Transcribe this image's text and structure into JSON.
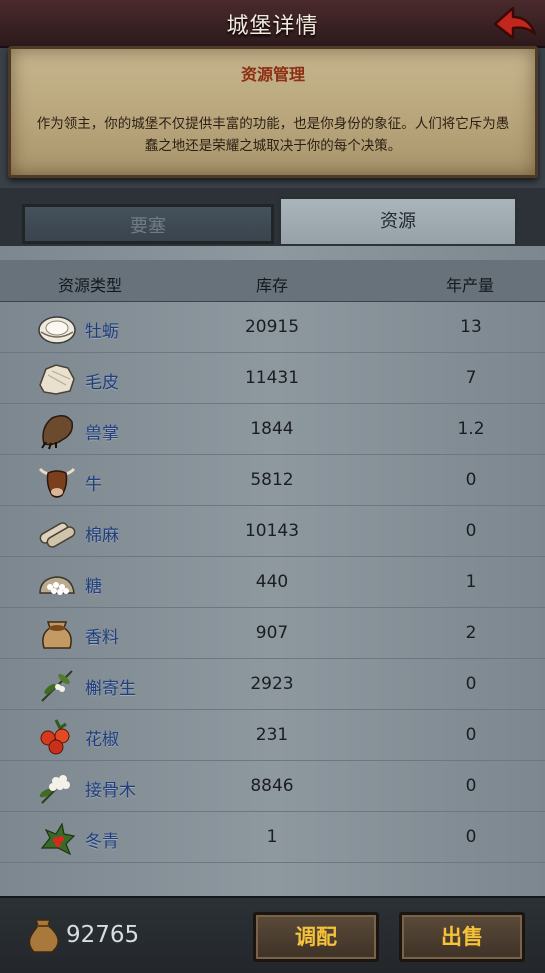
{
  "header": {
    "title": "城堡详情"
  },
  "panel": {
    "title": "资源管理",
    "text": "作为领主，你的城堡不仅提供丰富的功能，也是你身份的象征。人们将它斥为愚蠢之地还是荣耀之城取决于你的每个决策。"
  },
  "tabs": [
    {
      "label": "要塞",
      "active": false
    },
    {
      "label": "资源",
      "active": true
    }
  ],
  "table": {
    "columns": [
      "资源类型",
      "库存",
      "年产量"
    ],
    "rows": [
      {
        "icon": "oyster-icon",
        "name": "牡蛎",
        "stock": "20915",
        "yield": "13"
      },
      {
        "icon": "fur-icon",
        "name": "毛皮",
        "stock": "11431",
        "yield": "7"
      },
      {
        "icon": "paw-icon",
        "name": "兽掌",
        "stock": "1844",
        "yield": "1.2"
      },
      {
        "icon": "ox-icon",
        "name": "牛",
        "stock": "5812",
        "yield": "0"
      },
      {
        "icon": "linen-icon",
        "name": "棉麻",
        "stock": "10143",
        "yield": "0"
      },
      {
        "icon": "sugar-icon",
        "name": "糖",
        "stock": "440",
        "yield": "1"
      },
      {
        "icon": "spice-icon",
        "name": "香料",
        "stock": "907",
        "yield": "2"
      },
      {
        "icon": "mistletoe-icon",
        "name": "槲寄生",
        "stock": "2923",
        "yield": "0"
      },
      {
        "icon": "pepper-icon",
        "name": "花椒",
        "stock": "231",
        "yield": "0"
      },
      {
        "icon": "elder-icon",
        "name": "接骨木",
        "stock": "8846",
        "yield": "0"
      },
      {
        "icon": "holly-icon",
        "name": "冬青",
        "stock": "1",
        "yield": "0"
      }
    ]
  },
  "footer": {
    "currency": "92765",
    "allocate_label": "调配",
    "sell_label": "出售"
  }
}
